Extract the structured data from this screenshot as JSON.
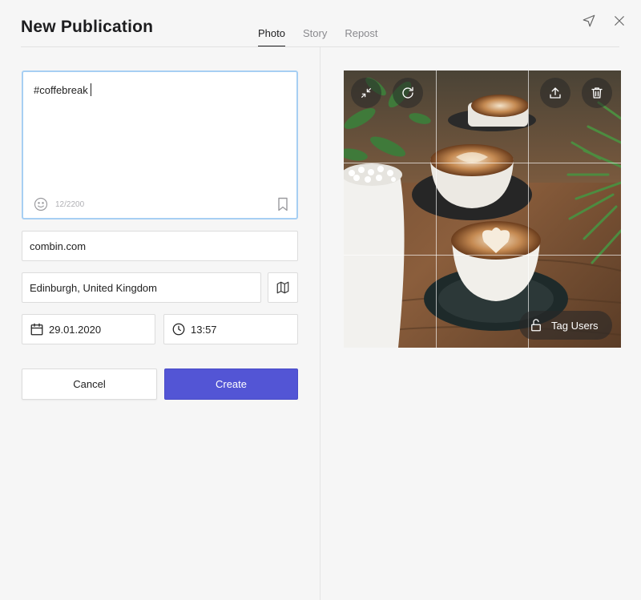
{
  "header": {
    "title": "New Publication",
    "tabs": [
      {
        "label": "Photo",
        "active": true
      },
      {
        "label": "Story",
        "active": false
      },
      {
        "label": "Repost",
        "active": false
      }
    ],
    "icons": [
      "send-icon",
      "close-icon"
    ]
  },
  "composer": {
    "caption": "#coffebreak",
    "counter": "12/2200",
    "icons": [
      "emoji-icon",
      "bookmark-icon"
    ]
  },
  "fields": {
    "link": "combin.com",
    "location": "Edinburgh, United Kingdom",
    "date": "29.01.2020",
    "time": "13:57"
  },
  "actions": {
    "cancel_label": "Cancel",
    "create_label": "Create"
  },
  "photo": {
    "tag_users_label": "Tag Users",
    "controls": [
      "collapse-icon",
      "rotate-icon",
      "upload-icon",
      "trash-icon",
      "unlock-icon"
    ]
  },
  "colors": {
    "accent": "#5355d5",
    "focus_border": "#a7cff3",
    "background": "#f6f6f6"
  }
}
